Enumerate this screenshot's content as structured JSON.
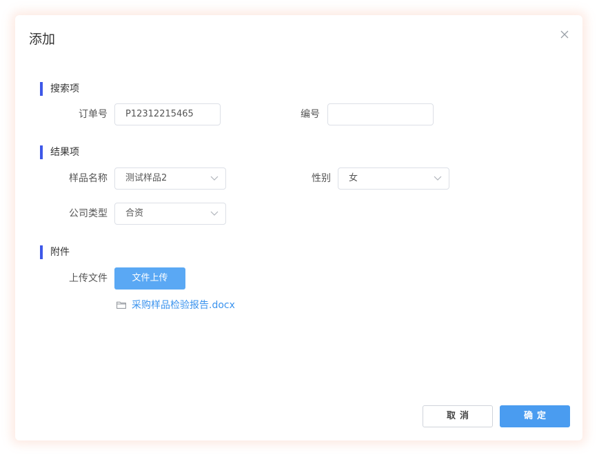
{
  "dialog": {
    "title": "添加",
    "close_icon": "close-icon"
  },
  "sections": {
    "search": {
      "title": "搜索项",
      "order_no_label": "订单号",
      "order_no_value": "P12312215465",
      "code_label": "编号",
      "code_value": ""
    },
    "result": {
      "title": "结果项",
      "sample_name_label": "样品名称",
      "sample_name_value": "测试样品2",
      "gender_label": "性别",
      "gender_value": "女",
      "company_type_label": "公司类型",
      "company_type_value": "合资"
    },
    "attachment": {
      "title": "附件",
      "upload_label": "上传文件",
      "upload_button": "文件上传",
      "file_name": "采购样品检验报告.docx",
      "file_icon": "folder-icon"
    }
  },
  "footer": {
    "cancel_label": "取消",
    "confirm_label": "确定"
  },
  "colors": {
    "accent_bar": "#3e58e8",
    "primary_button": "#4a9cf0",
    "upload_button": "#5aa8f4",
    "link": "#3a93ee"
  }
}
